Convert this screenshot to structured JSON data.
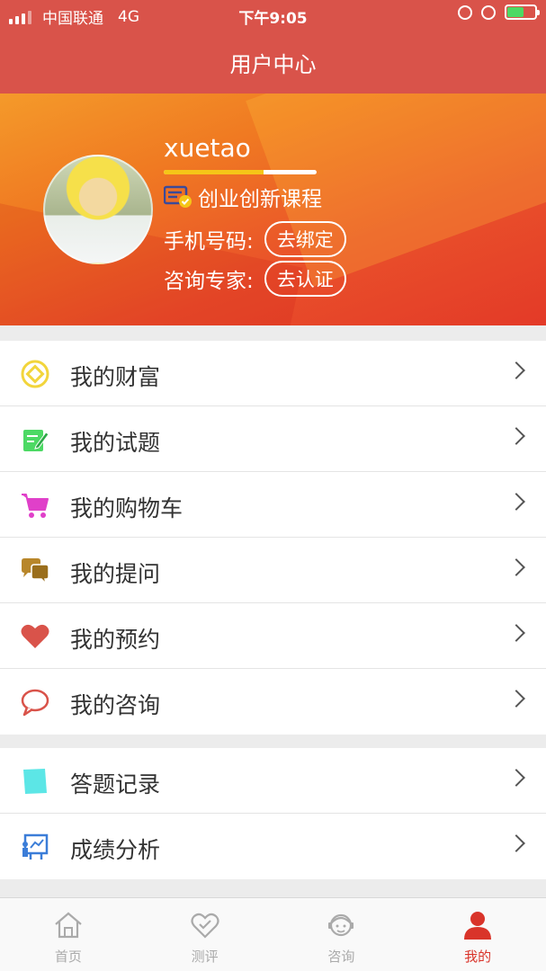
{
  "status_bar": {
    "carrier": "中国联通",
    "network": "4G",
    "time": "下午9:05"
  },
  "nav": {
    "title": "用户中心"
  },
  "profile": {
    "username": "xuetao",
    "level_progress": 0.65,
    "course": "创业创新课程",
    "phone_label": "手机号码:",
    "phone_action": "去绑定",
    "expert_label": "咨询专家:",
    "expert_action": "去认证"
  },
  "menu_primary": [
    {
      "label": "我的财富",
      "icon": "coin-icon",
      "color": "#f2d53c"
    },
    {
      "label": "我的试题",
      "icon": "edit-note-icon",
      "color": "#4cd964"
    },
    {
      "label": "我的购物车",
      "icon": "cart-icon",
      "color": "#e040c9"
    },
    {
      "label": "我的提问",
      "icon": "chat-bubbles-icon",
      "color": "#b8862a"
    },
    {
      "label": "我的预约",
      "icon": "heart-icon",
      "color": "#d9534a"
    },
    {
      "label": "我的咨询",
      "icon": "speech-bubble-icon",
      "color": "#d9534a"
    }
  ],
  "menu_secondary": [
    {
      "label": "答题记录",
      "icon": "answer-sheet-icon",
      "color": "#5ce6e6"
    },
    {
      "label": "成绩分析",
      "icon": "analysis-board-icon",
      "color": "#3b7dd8"
    }
  ],
  "tabbar": {
    "tabs": [
      {
        "label": "首页",
        "icon": "home-icon",
        "active": false
      },
      {
        "label": "测评",
        "icon": "heart-outline-icon",
        "active": false
      },
      {
        "label": "咨询",
        "icon": "consultant-icon",
        "active": false
      },
      {
        "label": "我的",
        "icon": "user-icon",
        "active": true
      }
    ]
  },
  "colors": {
    "accent": "#d9534a",
    "active_tab": "#d9342a"
  }
}
